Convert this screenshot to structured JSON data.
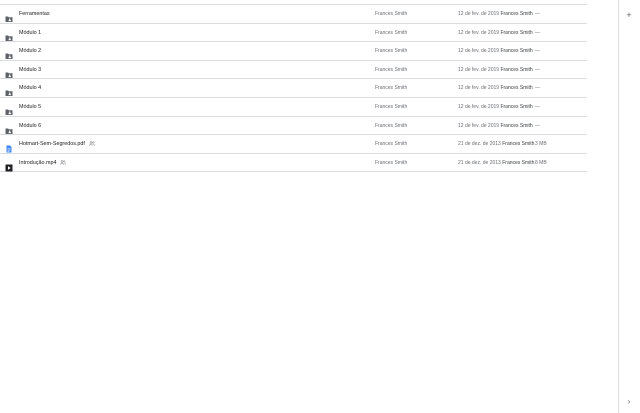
{
  "files": [
    {
      "name": "Ferramentas",
      "icon": "shared-folder-icon",
      "shared": false,
      "owner": "Frances Smith",
      "modified_date": "12 de fev. de 2019",
      "modified_by": "Frances Smith",
      "size": "—"
    },
    {
      "name": "Módulo 1",
      "icon": "shared-folder-icon",
      "shared": false,
      "owner": "Frances Smith",
      "modified_date": "12 de fev. de 2019",
      "modified_by": "Frances Smith",
      "size": "—"
    },
    {
      "name": "Módulo 2",
      "icon": "shared-folder-icon",
      "shared": false,
      "owner": "Frances Smith",
      "modified_date": "12 de fev. de 2019",
      "modified_by": "Frances Smith",
      "size": "—"
    },
    {
      "name": "Módulo 3",
      "icon": "shared-folder-icon",
      "shared": false,
      "owner": "Frances Smith",
      "modified_date": "12 de fev. de 2019",
      "modified_by": "Frances Smith",
      "size": "—"
    },
    {
      "name": "Módulo 4",
      "icon": "shared-folder-icon",
      "shared": false,
      "owner": "Frances Smith",
      "modified_date": "12 de fev. de 2019",
      "modified_by": "Frances Smith",
      "size": "—"
    },
    {
      "name": "Módulo 5",
      "icon": "shared-folder-icon",
      "shared": false,
      "owner": "Frances Smith",
      "modified_date": "12 de fev. de 2019",
      "modified_by": "Frances Smith",
      "size": "—"
    },
    {
      "name": "Módulo 6",
      "icon": "shared-folder-icon",
      "shared": false,
      "owner": "Frances Smith",
      "modified_date": "12 de fev. de 2019",
      "modified_by": "Frances Smith",
      "size": "—"
    },
    {
      "name": "Hotmart-Sem-Segredos.pdf",
      "icon": "document-icon",
      "shared": true,
      "owner": "Frances Smith",
      "modified_date": "21 de dez. de 2013",
      "modified_by": "Frances Smith",
      "size": "3 MB"
    },
    {
      "name": "Introdução.mp4",
      "icon": "video-icon",
      "shared": true,
      "owner": "Frances Smith",
      "modified_date": "21 de dez. de 2013",
      "modified_by": "Frances Smith",
      "size": "8 MB"
    }
  ],
  "side_panel": {
    "add_label": "+",
    "expand_label": "›"
  },
  "colors": {
    "folder": "#5f6368",
    "document": "#4285f4",
    "video": "#202124",
    "divider": "#dadce0"
  }
}
